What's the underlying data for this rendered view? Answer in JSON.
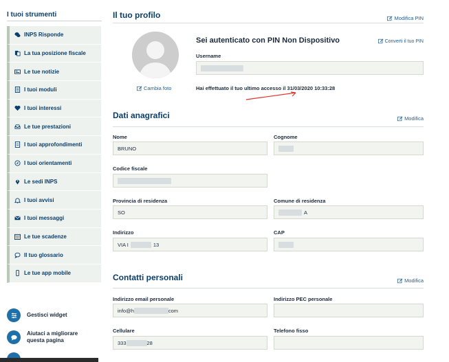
{
  "sidebar": {
    "title": "I tuoi strumenti",
    "items": [
      {
        "label": "INPS Risponde",
        "icon": "chat-bubbles-icon"
      },
      {
        "label": "La tua posizione fiscale",
        "icon": "documents-icon"
      },
      {
        "label": "Le tue notizie",
        "icon": "newspaper-icon"
      },
      {
        "label": "I tuoi moduli",
        "icon": "form-icon"
      },
      {
        "label": "I tuoi interessi",
        "icon": "heart-icon"
      },
      {
        "label": "Le tue prestazioni",
        "icon": "inbox-icon"
      },
      {
        "label": "I tuoi approfondimenti",
        "icon": "document-text-icon"
      },
      {
        "label": "I tuoi orientamenti",
        "icon": "compass-icon"
      },
      {
        "label": "Le sedi INPS",
        "icon": "map-pin-icon"
      },
      {
        "label": "I tuoi avvisi",
        "icon": "bell-icon"
      },
      {
        "label": "I tuoi messaggi",
        "icon": "envelope-icon"
      },
      {
        "label": "Le tue scadenze",
        "icon": "calendar-icon"
      },
      {
        "label": "Il tuo glossario",
        "icon": "speech-icon"
      },
      {
        "label": "Le tue app mobile",
        "icon": "mobile-icon"
      }
    ],
    "widget_label": "Gestisci widget",
    "feedback_label": "Aiutaci a migliorare questa pagina"
  },
  "profile": {
    "title": "Il tuo profilo",
    "modifica_pin": "Modifica PIN",
    "cambia_foto": "Cambia foto",
    "auth_title": "Sei autenticato con PIN Non Dispositivo",
    "converti_pin": "Converti il tuo PIN",
    "username_label": "Username",
    "last_access": "Hai effettuato il tuo ultimo accesso il 31/03/2020 10:33:28"
  },
  "anagrafici": {
    "title": "Dati anagrafici",
    "modifica": "Modifica",
    "nome_label": "Nome",
    "nome_value": "BRUNO",
    "cognome_label": "Cognome",
    "cf_label": "Codice fiscale",
    "provincia_label": "Provincia di residenza",
    "provincia_value": "SO",
    "comune_label": "Comune di residenza",
    "comune_suffix": "A",
    "indirizzo_label": "Indirizzo",
    "indirizzo_prefix": "VIA I",
    "indirizzo_suffix": "13",
    "cap_label": "CAP"
  },
  "contatti": {
    "title": "Contatti personali",
    "modifica": "Modifica",
    "email_label": "Indirizzo email personale",
    "email_prefix": "info@h",
    "email_suffix": "com",
    "pec_label": "Indirizzo PEC personale",
    "cell_label": "Cellulare",
    "cell_prefix": "333",
    "cell_suffix": "28",
    "fisso_label": "Telefono fisso"
  },
  "colors": {
    "accent": "#0a3e6b",
    "link": "#1f5e91",
    "sidebar_bg": "#eef2ee",
    "field_bg": "#f2f4f0",
    "arrow": "#e0312a"
  }
}
